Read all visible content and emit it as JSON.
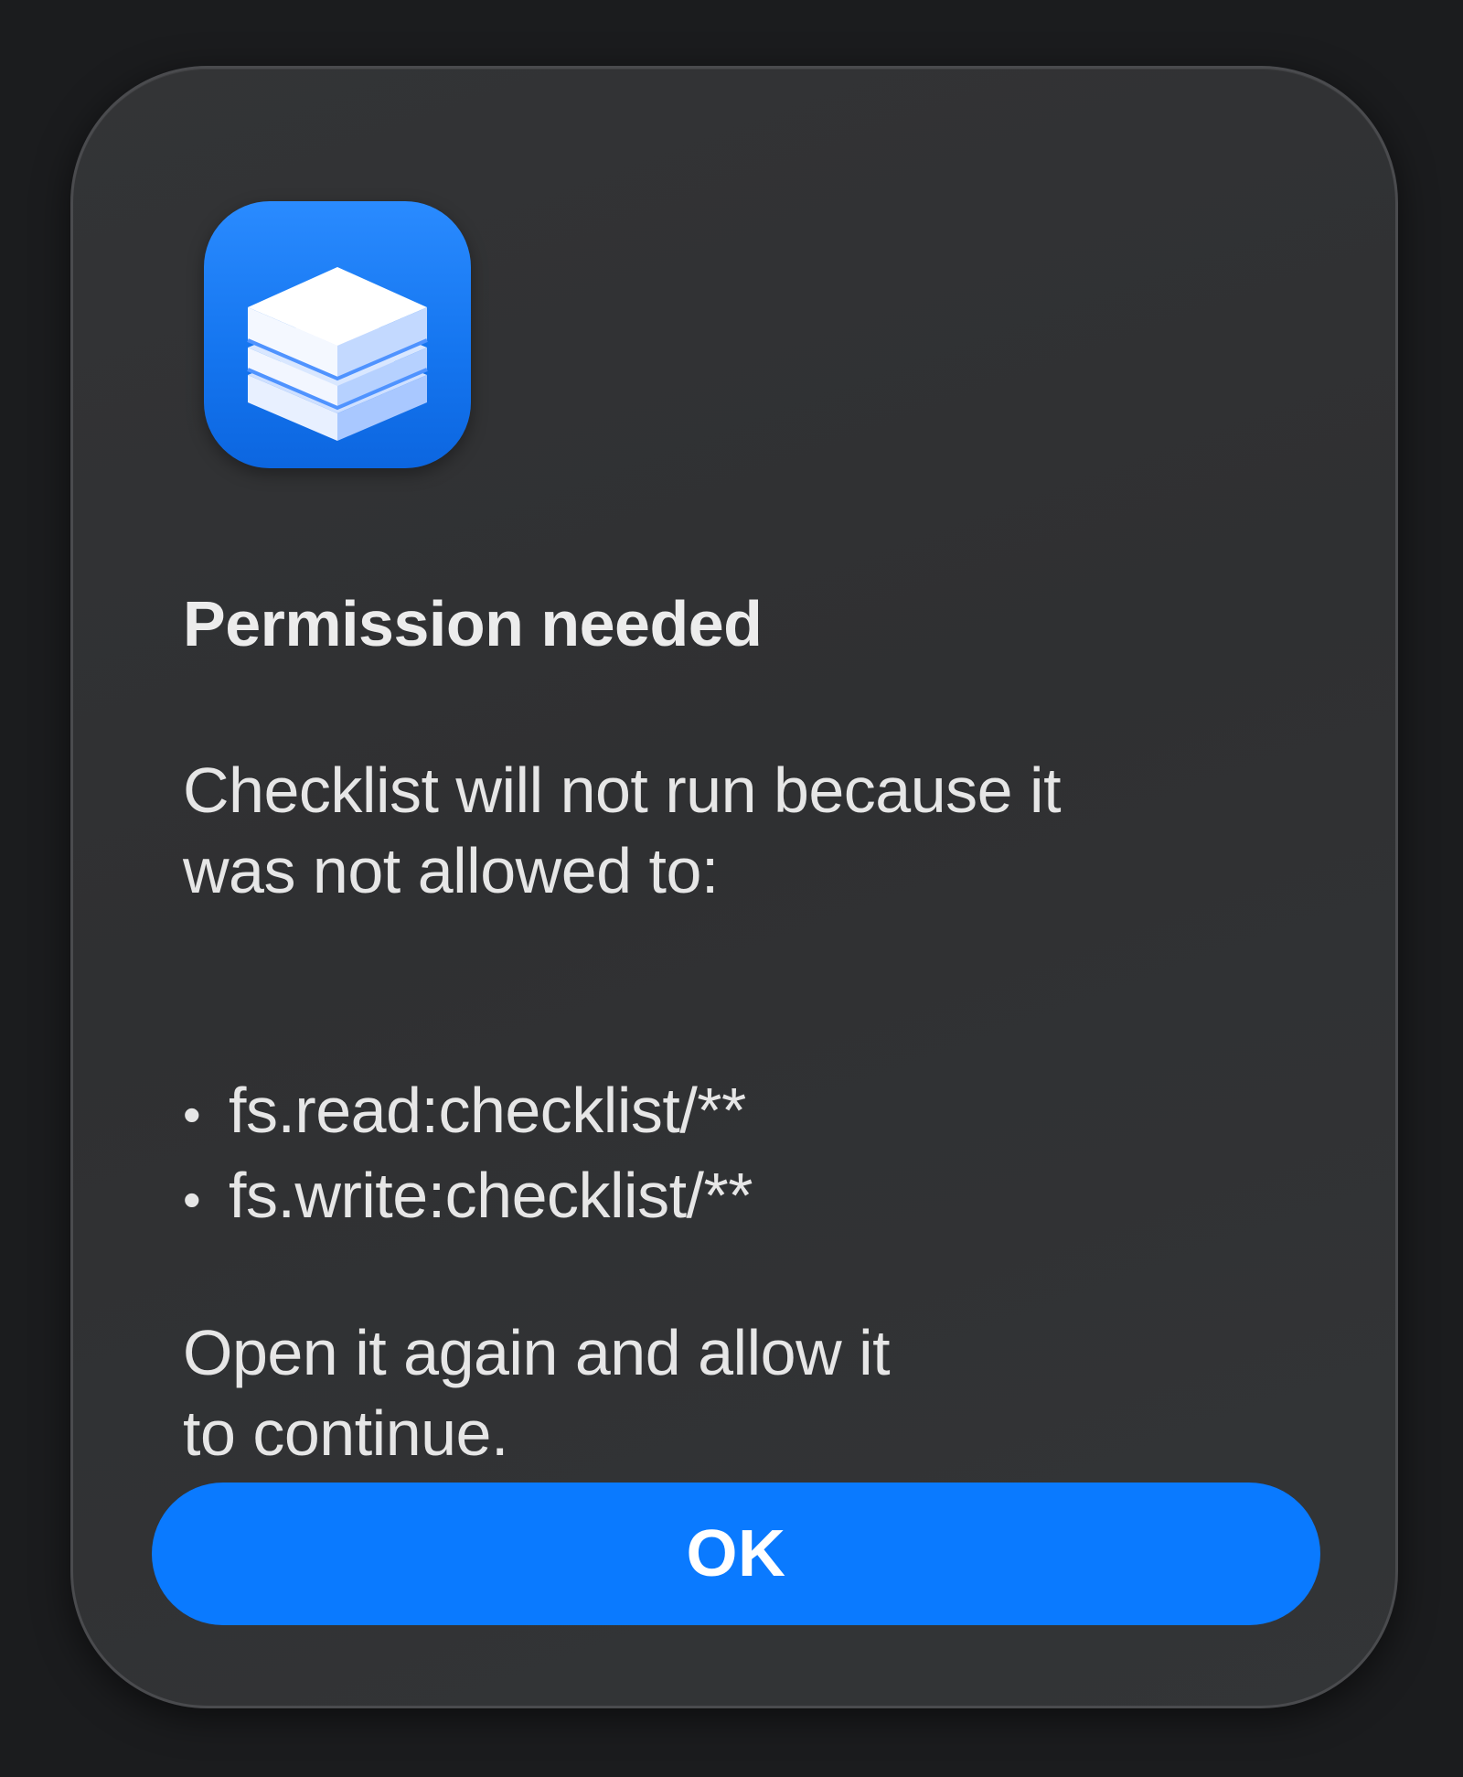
{
  "dialog": {
    "icon": "layered-box-app-icon",
    "title": "Permission needed",
    "message_lines": [
      "Checklist will not run because it",
      "was not allowed to:"
    ],
    "permissions": [
      "fs.read:checklist/**",
      "fs.write:checklist/**"
    ],
    "bullet": "•",
    "footer_lines": [
      "Open it again and allow it",
      "to continue."
    ],
    "ok_label": "OK"
  },
  "colors": {
    "accent": "#0a7aff",
    "dialog_bg": "#313234",
    "window_bg": "#1b1c1e",
    "text": "#e6e6e6"
  }
}
